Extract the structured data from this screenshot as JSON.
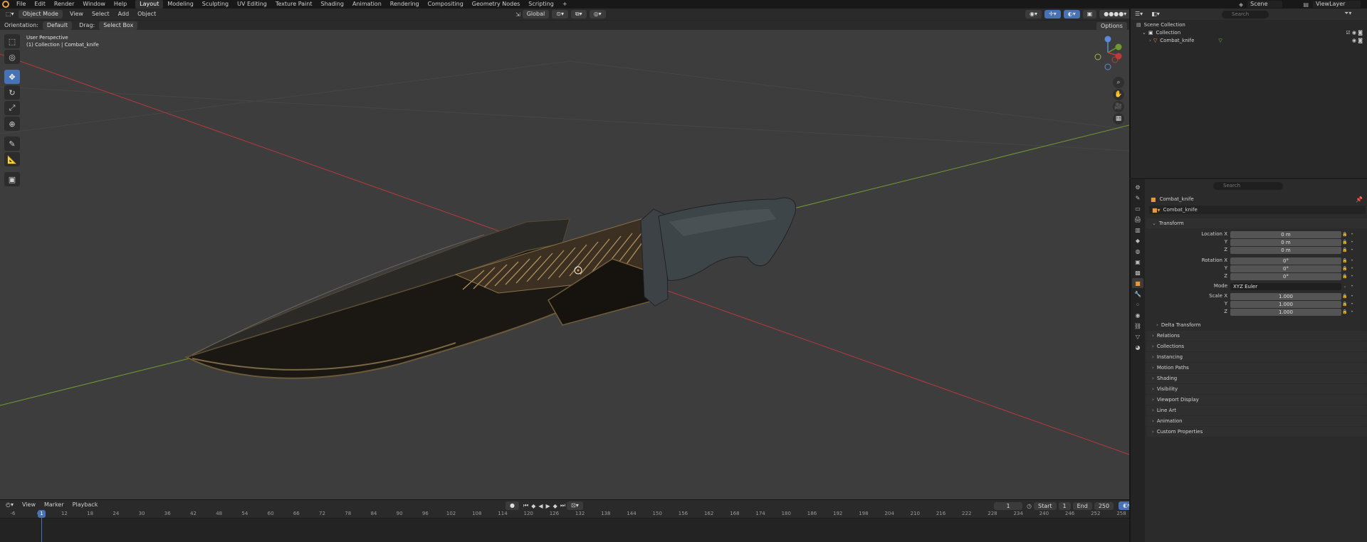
{
  "menu": [
    "File",
    "Edit",
    "Render",
    "Window",
    "Help"
  ],
  "workspaces": [
    "Layout",
    "Modeling",
    "Sculpting",
    "UV Editing",
    "Texture Paint",
    "Shading",
    "Animation",
    "Rendering",
    "Compositing",
    "Geometry Nodes",
    "Scripting"
  ],
  "active_workspace": "Layout",
  "add_workspace": "+",
  "scene": {
    "label": "Scene",
    "view_layer": "ViewLayer"
  },
  "viewport": {
    "mode": "Object Mode",
    "menus": [
      "View",
      "Select",
      "Add",
      "Object"
    ],
    "transform_orientation": "Global",
    "orientation_label": "Orientation:",
    "orientation_value": "Default",
    "drag_label": "Drag:",
    "drag_value": "Select Box",
    "options_label": "Options",
    "info_line1": "User Perspective",
    "info_line2": "(1) Collection | Combat_knife"
  },
  "timeline": {
    "menus": [
      "View",
      "Marker",
      "Playback"
    ],
    "current_frame": "1",
    "start_label": "Start",
    "start": "1",
    "end_label": "End",
    "end": "250",
    "ticks": [
      "-6",
      "6",
      "12",
      "18",
      "24",
      "30",
      "36",
      "42",
      "48",
      "54",
      "60",
      "66",
      "72",
      "78",
      "84",
      "90",
      "96",
      "102",
      "108",
      "114",
      "120",
      "126",
      "132",
      "138",
      "144",
      "150",
      "156",
      "162",
      "168",
      "174",
      "180",
      "186",
      "192",
      "198",
      "204",
      "210",
      "216",
      "222",
      "228",
      "234",
      "240",
      "246",
      "252",
      "258"
    ],
    "playhead_label": "1"
  },
  "outliner": {
    "search_placeholder": "Search",
    "scene_collection": "Scene Collection",
    "collection": "Collection",
    "object": "Combat_knife"
  },
  "properties": {
    "search_placeholder": "Search",
    "object_name": "Combat_knife",
    "datablock_name": "Combat_knife",
    "transform_label": "Transform",
    "location_x_label": "Location X",
    "y_label": "Y",
    "z_label": "Z",
    "location_x": "0 m",
    "location_y": "0 m",
    "location_z": "0 m",
    "rotation_x_label": "Rotation X",
    "rotation_x": "0°",
    "rotation_y": "0°",
    "rotation_z": "0°",
    "mode_label": "Mode",
    "mode_value": "XYZ Euler",
    "scale_x_label": "Scale X",
    "scale_x": "1.000",
    "scale_y": "1.000",
    "scale_z": "1.000",
    "delta_transform": "Delta Transform",
    "panels": [
      "Relations",
      "Collections",
      "Instancing",
      "Motion Paths",
      "Shading",
      "Visibility",
      "Viewport Display",
      "Line Art",
      "Animation",
      "Custom Properties"
    ]
  },
  "colors": {
    "accent": "#4772b3",
    "x_axis": "#c0393b",
    "y_axis": "#6f9a32",
    "origin_orange": "#e89a3a"
  }
}
